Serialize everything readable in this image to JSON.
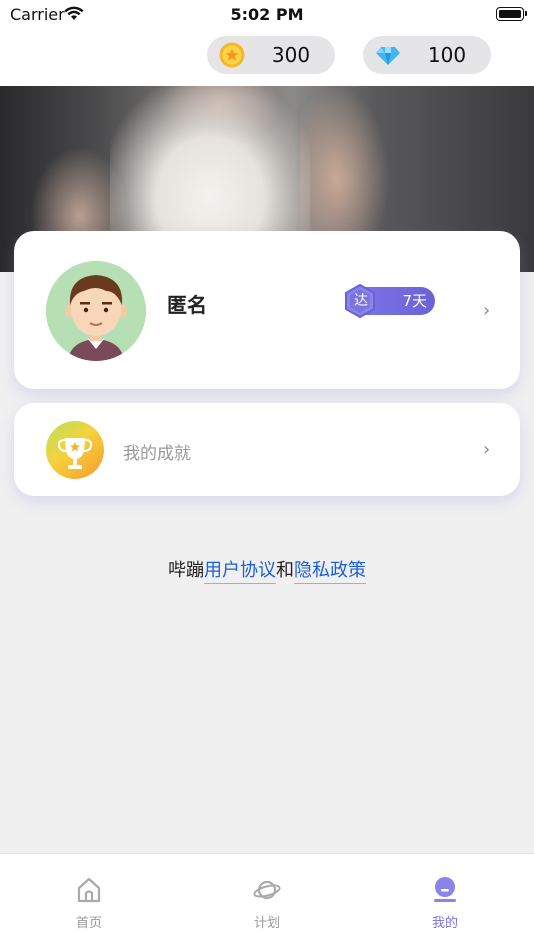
{
  "status_bar": {
    "carrier": "Carrier",
    "time": "5:02 PM"
  },
  "currency": {
    "coins": {
      "icon": "coin-icon",
      "value": "300"
    },
    "gems": {
      "icon": "diamond-icon",
      "value": "100"
    }
  },
  "profile": {
    "name": "匿名",
    "badge_char": "达",
    "badge_days": "7天"
  },
  "achievement": {
    "label": "我的成就"
  },
  "agreement": {
    "prefix": "哔蹦",
    "user_agreement": "用户协议",
    "and": "和",
    "privacy_policy": "隐私政策"
  },
  "tabs": [
    {
      "label": "首页",
      "icon": "home-icon",
      "active": false
    },
    {
      "label": "计划",
      "icon": "planet-icon",
      "active": false
    },
    {
      "label": "我的",
      "icon": "profile-icon",
      "active": true
    }
  ],
  "colors": {
    "accent": "#7a73e0",
    "link": "#1d5fd6",
    "badge": "#7e78e8"
  }
}
